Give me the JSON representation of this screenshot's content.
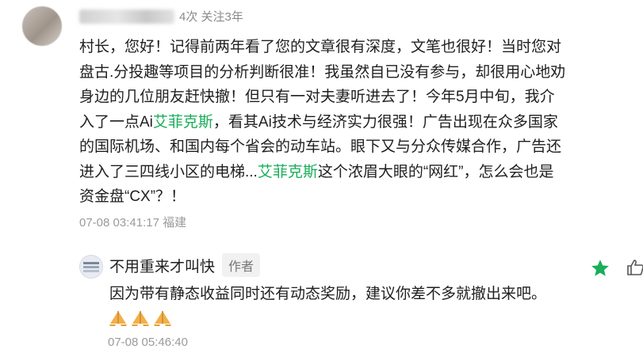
{
  "comment": {
    "meta_visible": "4次 关注3年",
    "body_segments": [
      {
        "text": "村长，您好！记得前两年看了您的文章很有深度，文笔也很好！当时您对盘古.分投趣等项目的分析判断很准！我虽然自已没有参与，却很用心地劝身边的几位朋友赶快撤！但只有一对夫妻听进去了！今年5月中旬，我介入了一点Ai"
      },
      {
        "text": "艾菲克斯",
        "link": true
      },
      {
        "text": "，看其Ai技术与经济实力很强！广告出现在众多国家的国际机场、和国内每个省会的动车站。眼下又与分众传媒合作，广告还进入了三四线小区的电梯..."
      },
      {
        "text": "艾菲克斯",
        "link": true
      },
      {
        "text": "这个浓眉大眼的“网红”，怎么会也是资金盘“CX”？！"
      }
    ],
    "timestamp": "07-08 03:41:17 福建"
  },
  "reply": {
    "author": "不用重来才叫快",
    "author_tag": "作者",
    "text": "因为带有静态收益同时还有动态奖励，建议你差不多就撤出来吧。",
    "emoji_icon": "folded-hands-icon",
    "emoji_count": 3,
    "timestamp": "07-08 05:46:40"
  },
  "actions": {
    "star_icon": "star-icon",
    "like_icon": "thumbs-up-icon",
    "star_color": "#1aad5a"
  }
}
